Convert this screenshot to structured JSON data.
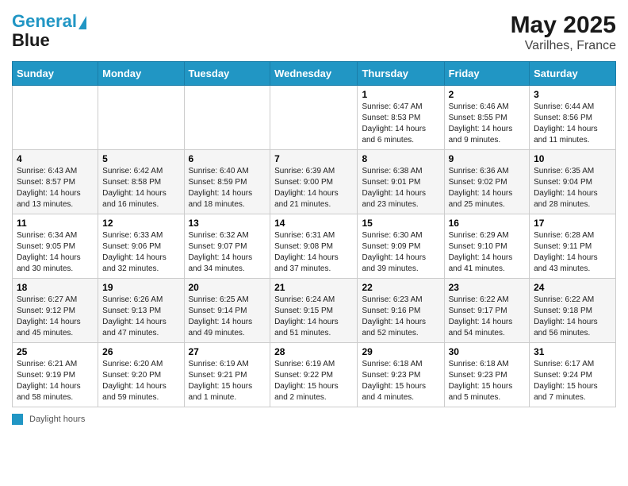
{
  "header": {
    "logo_line1": "General",
    "logo_line2": "Blue",
    "month_year": "May 2025",
    "location": "Varilhes, France"
  },
  "days_of_week": [
    "Sunday",
    "Monday",
    "Tuesday",
    "Wednesday",
    "Thursday",
    "Friday",
    "Saturday"
  ],
  "weeks": [
    [
      {
        "day": "",
        "info": ""
      },
      {
        "day": "",
        "info": ""
      },
      {
        "day": "",
        "info": ""
      },
      {
        "day": "",
        "info": ""
      },
      {
        "day": "1",
        "info": "Sunrise: 6:47 AM\nSunset: 8:53 PM\nDaylight: 14 hours and 6 minutes."
      },
      {
        "day": "2",
        "info": "Sunrise: 6:46 AM\nSunset: 8:55 PM\nDaylight: 14 hours and 9 minutes."
      },
      {
        "day": "3",
        "info": "Sunrise: 6:44 AM\nSunset: 8:56 PM\nDaylight: 14 hours and 11 minutes."
      }
    ],
    [
      {
        "day": "4",
        "info": "Sunrise: 6:43 AM\nSunset: 8:57 PM\nDaylight: 14 hours and 13 minutes."
      },
      {
        "day": "5",
        "info": "Sunrise: 6:42 AM\nSunset: 8:58 PM\nDaylight: 14 hours and 16 minutes."
      },
      {
        "day": "6",
        "info": "Sunrise: 6:40 AM\nSunset: 8:59 PM\nDaylight: 14 hours and 18 minutes."
      },
      {
        "day": "7",
        "info": "Sunrise: 6:39 AM\nSunset: 9:00 PM\nDaylight: 14 hours and 21 minutes."
      },
      {
        "day": "8",
        "info": "Sunrise: 6:38 AM\nSunset: 9:01 PM\nDaylight: 14 hours and 23 minutes."
      },
      {
        "day": "9",
        "info": "Sunrise: 6:36 AM\nSunset: 9:02 PM\nDaylight: 14 hours and 25 minutes."
      },
      {
        "day": "10",
        "info": "Sunrise: 6:35 AM\nSunset: 9:04 PM\nDaylight: 14 hours and 28 minutes."
      }
    ],
    [
      {
        "day": "11",
        "info": "Sunrise: 6:34 AM\nSunset: 9:05 PM\nDaylight: 14 hours and 30 minutes."
      },
      {
        "day": "12",
        "info": "Sunrise: 6:33 AM\nSunset: 9:06 PM\nDaylight: 14 hours and 32 minutes."
      },
      {
        "day": "13",
        "info": "Sunrise: 6:32 AM\nSunset: 9:07 PM\nDaylight: 14 hours and 34 minutes."
      },
      {
        "day": "14",
        "info": "Sunrise: 6:31 AM\nSunset: 9:08 PM\nDaylight: 14 hours and 37 minutes."
      },
      {
        "day": "15",
        "info": "Sunrise: 6:30 AM\nSunset: 9:09 PM\nDaylight: 14 hours and 39 minutes."
      },
      {
        "day": "16",
        "info": "Sunrise: 6:29 AM\nSunset: 9:10 PM\nDaylight: 14 hours and 41 minutes."
      },
      {
        "day": "17",
        "info": "Sunrise: 6:28 AM\nSunset: 9:11 PM\nDaylight: 14 hours and 43 minutes."
      }
    ],
    [
      {
        "day": "18",
        "info": "Sunrise: 6:27 AM\nSunset: 9:12 PM\nDaylight: 14 hours and 45 minutes."
      },
      {
        "day": "19",
        "info": "Sunrise: 6:26 AM\nSunset: 9:13 PM\nDaylight: 14 hours and 47 minutes."
      },
      {
        "day": "20",
        "info": "Sunrise: 6:25 AM\nSunset: 9:14 PM\nDaylight: 14 hours and 49 minutes."
      },
      {
        "day": "21",
        "info": "Sunrise: 6:24 AM\nSunset: 9:15 PM\nDaylight: 14 hours and 51 minutes."
      },
      {
        "day": "22",
        "info": "Sunrise: 6:23 AM\nSunset: 9:16 PM\nDaylight: 14 hours and 52 minutes."
      },
      {
        "day": "23",
        "info": "Sunrise: 6:22 AM\nSunset: 9:17 PM\nDaylight: 14 hours and 54 minutes."
      },
      {
        "day": "24",
        "info": "Sunrise: 6:22 AM\nSunset: 9:18 PM\nDaylight: 14 hours and 56 minutes."
      }
    ],
    [
      {
        "day": "25",
        "info": "Sunrise: 6:21 AM\nSunset: 9:19 PM\nDaylight: 14 hours and 58 minutes."
      },
      {
        "day": "26",
        "info": "Sunrise: 6:20 AM\nSunset: 9:20 PM\nDaylight: 14 hours and 59 minutes."
      },
      {
        "day": "27",
        "info": "Sunrise: 6:19 AM\nSunset: 9:21 PM\nDaylight: 15 hours and 1 minute."
      },
      {
        "day": "28",
        "info": "Sunrise: 6:19 AM\nSunset: 9:22 PM\nDaylight: 15 hours and 2 minutes."
      },
      {
        "day": "29",
        "info": "Sunrise: 6:18 AM\nSunset: 9:23 PM\nDaylight: 15 hours and 4 minutes."
      },
      {
        "day": "30",
        "info": "Sunrise: 6:18 AM\nSunset: 9:23 PM\nDaylight: 15 hours and 5 minutes."
      },
      {
        "day": "31",
        "info": "Sunrise: 6:17 AM\nSunset: 9:24 PM\nDaylight: 15 hours and 7 minutes."
      }
    ]
  ],
  "footer": {
    "daylight_label": "Daylight hours"
  }
}
